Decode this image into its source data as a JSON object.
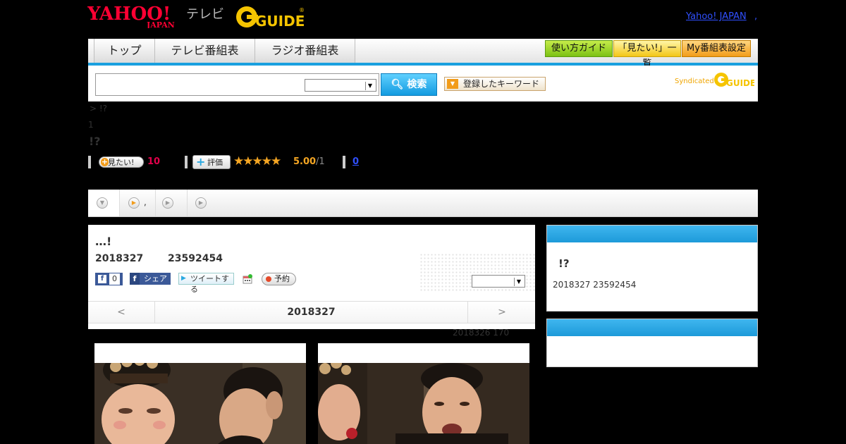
{
  "header": {
    "yahoo_logo": "YAHOO!",
    "yahoo_sub": "JAPAN",
    "tv_label": "テレビ",
    "gguide_logo": "GUIDE",
    "gguide_reg": "®",
    "top_link": "Yahoo! JAPAN",
    "top_link_suffix": ","
  },
  "nav": {
    "tabs": [
      "トップ",
      "テレビ番組表",
      "ラジオ番組表"
    ],
    "buttons": [
      "使い方ガイド",
      "「見たい!」一覧",
      "My番組表設定"
    ]
  },
  "search": {
    "input_value": "",
    "select_value": "",
    "button_label": "検索",
    "keyword_button": "登録したキーワード",
    "syndicated": "Syndicated",
    "syndicated_logo": "GUIDE"
  },
  "page": {
    "breadcrumb": "> !?",
    "small_text": "1",
    "title": "!?",
    "mitai_label": "見たい!",
    "mitai_count": "10",
    "hyoka_label": "評価",
    "stars": "★★★★★",
    "score": "5.00",
    "score_den": "/1",
    "review_count": "0"
  },
  "tabs_strip": {
    "second_tab_label": ","
  },
  "program": {
    "heading": "…!",
    "date": "2018327",
    "time": "23592454",
    "fb_like_count": "0",
    "fb_share_label": "シェア",
    "tweet_label": "ツイートする",
    "yoyaku_label": "予約",
    "select_value": "",
    "date_nav": {
      "prev": "<",
      "current": "2018327",
      "next": ">"
    },
    "meta_line": "2018326  170"
  },
  "sidebar": {
    "box1_title": "!?",
    "box1_meta": "2018327  23592454"
  }
}
